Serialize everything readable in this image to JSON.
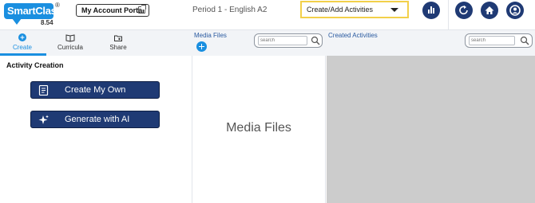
{
  "header": {
    "logo": {
      "brand": "SmartClass",
      "registered": "®",
      "version": "8.54"
    },
    "portal_button": "My Account Portal",
    "period": "Period 1 - English A2",
    "activity_select": {
      "selected": "Create/Add Activities"
    },
    "icons": [
      "bar-chart-icon",
      "refresh-icon",
      "home-icon",
      "user-icon"
    ],
    "accent_color": "#1f3a74",
    "highlight_color": "#f2d04a"
  },
  "tabs": [
    {
      "label": "Create",
      "icon": "plus-circle-icon",
      "active": true
    },
    {
      "label": "Curricula",
      "icon": "book-icon"
    },
    {
      "label": "Share",
      "icon": "share-folder-icon"
    }
  ],
  "media": {
    "title": "Media Files",
    "search_placeholder": "search",
    "placeholder_text": "Media Files"
  },
  "created": {
    "title": "Created Activities",
    "search_placeholder": "search"
  },
  "activity_creation": {
    "title": "Activity Creation",
    "buttons": [
      {
        "label": "Create My Own",
        "icon": "document-icon"
      },
      {
        "label": "Generate with AI",
        "icon": "sparkle-icon"
      }
    ]
  },
  "colors": {
    "primary_blue": "#1a8fe0",
    "button_navy": "#1f3a74",
    "created_bg": "#cccccc"
  }
}
